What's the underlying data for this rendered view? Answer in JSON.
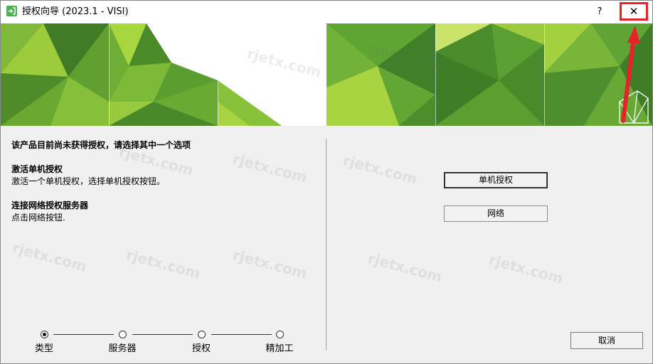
{
  "window": {
    "title": "授权向导 (2023.1 - VISI)",
    "help_label": "?",
    "close_label": "✕"
  },
  "icons": {
    "app": "license-wizard-icon",
    "help": "help-icon",
    "close": "close-icon",
    "banner_logo": "visi-logo-icon"
  },
  "colors": {
    "brand_green": "#5a9e2f",
    "annotation_red": "#e8212a",
    "window_bg": "#f0f0f0",
    "title_bar_bg": "#ffffff"
  },
  "intro": {
    "heading": "该产品目前尚未获得授权，请选择其中一个选项"
  },
  "options": {
    "standalone": {
      "title": "激活单机授权",
      "description": "激活一个单机授权，选择单机授权按钮。"
    },
    "network": {
      "title": "连接网络授权服务器",
      "description": "点击网络按钮."
    }
  },
  "buttons": {
    "standalone": "单机授权",
    "network": "网络",
    "cancel": "取消"
  },
  "steps": [
    {
      "label": "类型",
      "selected": true
    },
    {
      "label": "服务器",
      "selected": false
    },
    {
      "label": "授权",
      "selected": false
    },
    {
      "label": "精加工",
      "selected": false
    }
  ],
  "watermark": "rjetx.com"
}
